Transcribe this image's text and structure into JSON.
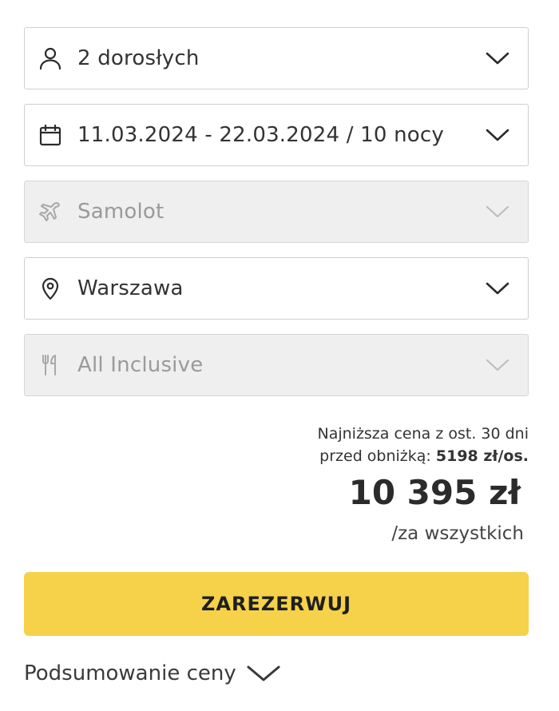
{
  "fields": [
    {
      "label": "2 dorosłych",
      "icon": "person-icon",
      "disabled": false
    },
    {
      "label": "11.03.2024 - 22.03.2024 / 10 nocy",
      "icon": "calendar-icon",
      "disabled": false
    },
    {
      "label": "Samolot",
      "icon": "plane-icon",
      "disabled": true
    },
    {
      "label": "Warszawa",
      "icon": "location-pin-icon",
      "disabled": false
    },
    {
      "label": "All Inclusive",
      "icon": "cutlery-icon",
      "disabled": true
    }
  ],
  "price": {
    "lowest_line1": "Najniższa cena z ost. 30 dni",
    "lowest_line2_prefix": "przed obniżką:",
    "lowest_value": "5198 zł/os.",
    "total": "10 395 zł",
    "total_suffix": "/za wszystkich"
  },
  "book_button": {
    "label": "ZAREZERWUJ"
  },
  "summary": {
    "label": "Podsumowanie ceny"
  },
  "colors": {
    "accent": "#f6d24a",
    "border": "#cfcfcf",
    "disabled_bg": "#efefef",
    "disabled_text": "#9a9a9a"
  }
}
